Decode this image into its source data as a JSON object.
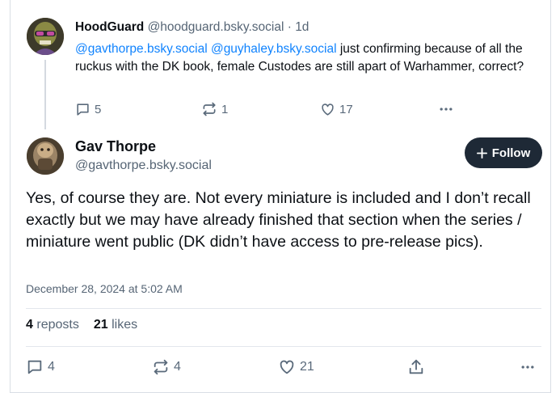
{
  "parent_post": {
    "author_name": "HoodGuard",
    "author_handle": "@hoodguard.bsky.social",
    "separator": "·",
    "age": "1d",
    "mention_1": "@gavthorpe.bsky.social",
    "mention_2": "@guyhaley.bsky.social",
    "text": " just confirming because of all the ruckus with the DK book, female Custodes are still apart of Warhammer, correct?",
    "replies": "5",
    "reposts": "1",
    "likes": "17"
  },
  "main_post": {
    "author_name": "Gav Thorpe",
    "author_handle": "@gavthorpe.bsky.social",
    "follow_label": "Follow",
    "text": "Yes, of course they are. Not every miniature is included and I don’t recall exactly but we may have already finished that section when the series / miniature went public (DK didn’t have access to pre-release pics).",
    "date": "December 28, 2024 at 5:02 AM",
    "repost_count": "4",
    "repost_label": "reposts",
    "like_count": "21",
    "like_label": "likes",
    "action_replies": "4",
    "action_reposts": "4",
    "action_likes": "21"
  },
  "colors": {
    "mention": "#1083fe",
    "follow_button": "#1e2936",
    "muted": "#566575"
  }
}
